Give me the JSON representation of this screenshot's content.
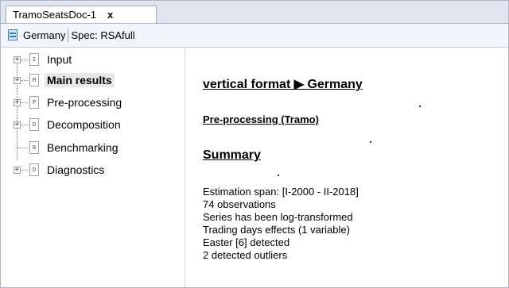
{
  "tab": {
    "label": "TramoSeatsDoc-1",
    "close": "x"
  },
  "toolbar": {
    "series": "Germany",
    "spec": "Spec: RSAfull"
  },
  "tree": {
    "items": [
      {
        "label": "Input",
        "icon": "I",
        "expandable": true,
        "selected": false
      },
      {
        "label": "Main results",
        "icon": "M",
        "expandable": true,
        "selected": true
      },
      {
        "label": "Pre-processing",
        "icon": "P",
        "expandable": true,
        "selected": false
      },
      {
        "label": "Decomposition",
        "icon": "D",
        "expandable": true,
        "selected": false
      },
      {
        "label": "Benchmarking",
        "icon": "B",
        "expandable": false,
        "selected": false
      },
      {
        "label": "Diagnostics",
        "icon": "D",
        "expandable": true,
        "selected": false
      }
    ]
  },
  "content": {
    "heading": "vertical format ▶ Germany",
    "preprocessing_link": "Pre-processing (Tramo)",
    "summary_heading": "Summary",
    "summary_lines": [
      "Estimation span: [I-2000 - II-2018]",
      "74 observations",
      "Series has been log-transformed",
      "Trading days effects (1 variable)",
      "Easter [6] detected",
      "2 detected outliers"
    ]
  }
}
